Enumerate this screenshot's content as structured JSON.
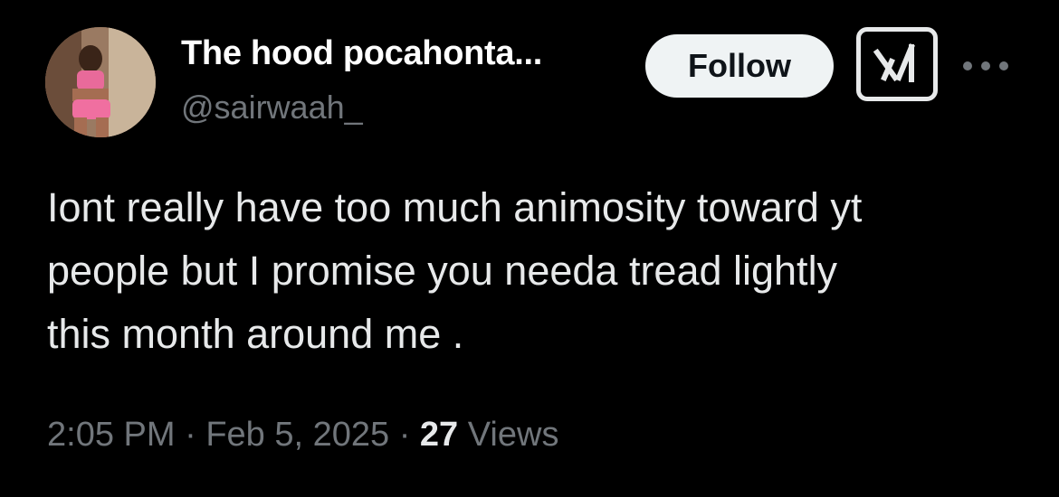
{
  "user": {
    "display_name": "The hood pocahonta...",
    "handle": "@sairwaah_"
  },
  "actions": {
    "follow_label": "Follow",
    "grok_icon": "grok-icon",
    "more_icon": "more-icon"
  },
  "tweet": {
    "lines": [
      "Iont really have too much animosity toward yt",
      "people but I promise you needa tread lightly",
      "this month around me ."
    ]
  },
  "meta": {
    "time": "2:05 PM",
    "sep1": "·",
    "date": "Feb 5, 2025",
    "sep2": "·",
    "views_count": "27",
    "views_label": "Views"
  },
  "colors": {
    "background": "#000000",
    "text": "#e7e9ea",
    "muted": "#71767b",
    "follow_bg": "#eff3f4"
  }
}
